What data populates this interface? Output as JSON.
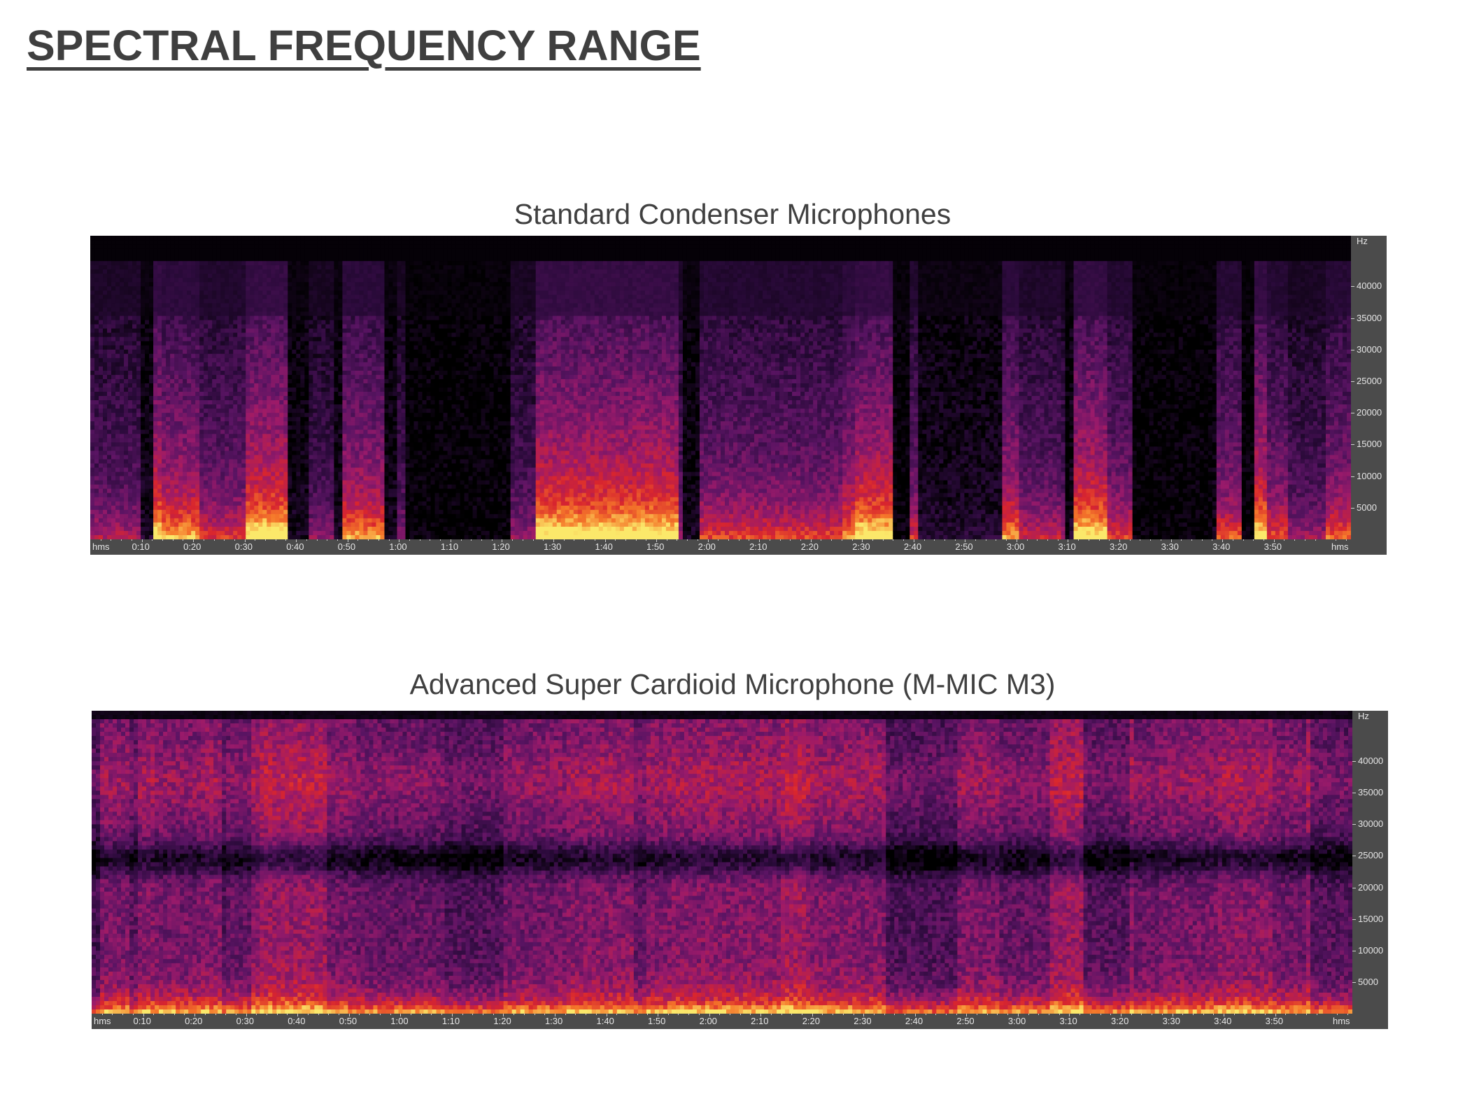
{
  "page": {
    "title": "SPECTRAL FREQUENCY RANGE"
  },
  "chart_data": [
    {
      "type": "heatmap",
      "title": "Standard Condenser Microphones",
      "x_unit_label": "hms",
      "y_unit_label": "Hz",
      "x_ticks": [
        "0:10",
        "0:20",
        "0:30",
        "0:40",
        "0:50",
        "1:00",
        "1:10",
        "1:20",
        "1:30",
        "1:40",
        "1:50",
        "2:00",
        "2:10",
        "2:20",
        "2:30",
        "2:40",
        "2:50",
        "3:00",
        "3:10",
        "3:20",
        "3:30",
        "3:40",
        "3:50"
      ],
      "y_ticks": [
        5000,
        10000,
        15000,
        20000,
        25000,
        30000,
        35000,
        40000
      ],
      "xlim_seconds": [
        0,
        245
      ],
      "ylim_hz": [
        0,
        48000
      ],
      "colormap": [
        "#000000",
        "#2a0a3a",
        "#5a1463",
        "#9a1a6a",
        "#d8252e",
        "#f5782a",
        "#fbe86a"
      ],
      "profile": "content mostly below 35000 Hz with energy concentrated below 5000 Hz; intermittent bursts, dark gaps"
    },
    {
      "type": "heatmap",
      "title": "Advanced Super Cardioid Microphone (M-MIC M3)",
      "x_unit_label": "hms",
      "y_unit_label": "Hz",
      "x_ticks": [
        "0:10",
        "0:20",
        "0:30",
        "0:40",
        "0:50",
        "1:00",
        "1:10",
        "1:20",
        "1:30",
        "1:40",
        "1:50",
        "2:00",
        "2:10",
        "2:20",
        "2:30",
        "2:40",
        "2:50",
        "3:00",
        "3:10",
        "3:20",
        "3:30",
        "3:40",
        "3:50"
      ],
      "y_ticks": [
        5000,
        10000,
        15000,
        20000,
        25000,
        30000,
        35000,
        40000
      ],
      "xlim_seconds": [
        0,
        245
      ],
      "ylim_hz": [
        0,
        48000
      ],
      "colormap": [
        "#000000",
        "#2a0a3a",
        "#5a1463",
        "#9a1a6a",
        "#d8252e",
        "#f5782a",
        "#fbe86a"
      ],
      "profile": "dense energy across full range up to ~45000 Hz, dark band near 25000 Hz, bright yellow below 3000 Hz"
    }
  ]
}
